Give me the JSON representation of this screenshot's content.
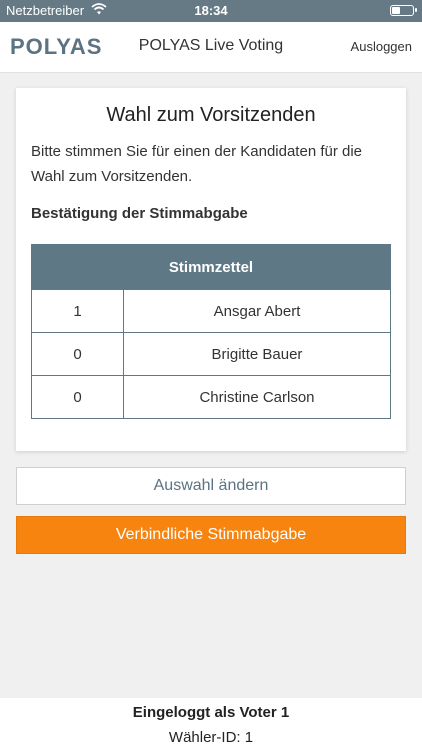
{
  "status_bar": {
    "carrier": "Netzbetreiber",
    "time": "18:34",
    "wifi_icon": "wifi-icon",
    "battery_icon": "battery-icon",
    "battery_level": 0.4
  },
  "navbar": {
    "logo": "POLYAS",
    "title": "POLYAS Live Voting",
    "logout_label": "Ausloggen"
  },
  "card": {
    "title": "Wahl zum Vorsitzenden",
    "description": "Bitte stimmen Sie für einen der Kandidaten für die Wahl zum Vorsitzenden.",
    "subheading": "Bestätigung der Stimmabgabe",
    "table": {
      "header": "Stimmzettel",
      "rows": [
        {
          "votes": "1",
          "name": "Ansgar Abert"
        },
        {
          "votes": "0",
          "name": "Brigitte Bauer"
        },
        {
          "votes": "0",
          "name": "Christine Carlson"
        }
      ]
    }
  },
  "actions": {
    "change_label": "Auswahl ändern",
    "submit_label": "Verbindliche Stimmabgabe"
  },
  "footer": {
    "logged_in": "Eingeloggt als Voter 1",
    "voter_id": "Wähler-ID: 1"
  },
  "colors": {
    "header_bar": "#667a86",
    "table_header": "#5f7886",
    "accent": "#f7840f"
  }
}
